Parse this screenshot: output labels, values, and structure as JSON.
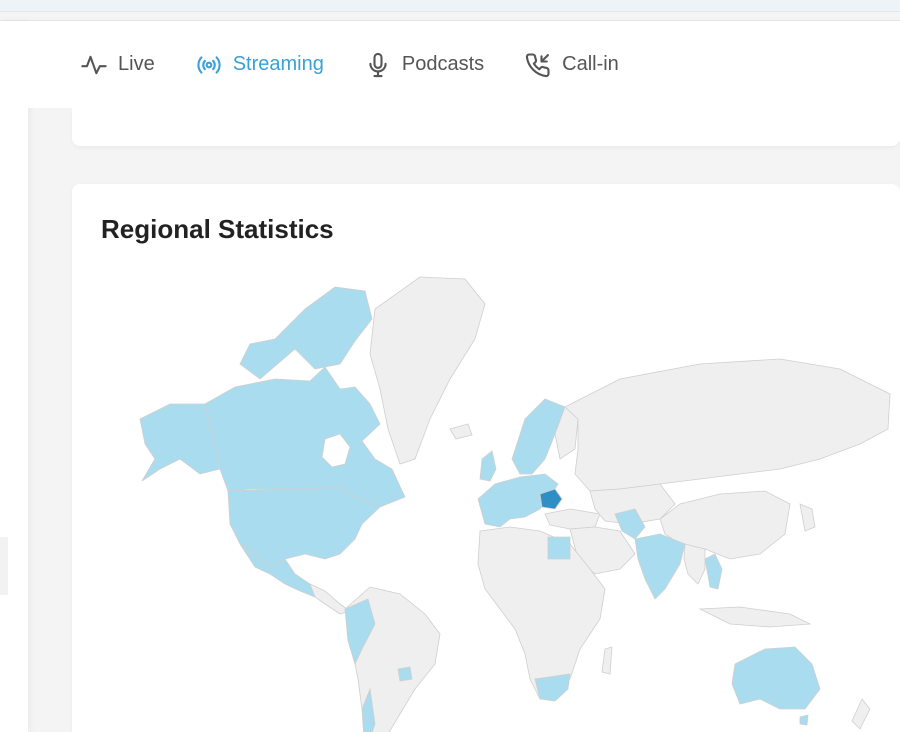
{
  "nav": {
    "items": [
      {
        "label": "Live",
        "icon": "activity-icon",
        "active": false
      },
      {
        "label": "Streaming",
        "icon": "broadcast-icon",
        "active": true
      },
      {
        "label": "Podcasts",
        "icon": "microphone-icon",
        "active": false
      },
      {
        "label": "Call-in",
        "icon": "phone-incoming-icon",
        "active": false
      }
    ]
  },
  "regional": {
    "title": "Regional Statistics",
    "colors": {
      "highlight": "#a9dcee",
      "top": "#2f8fc4",
      "base": "#efefef",
      "accent": "#3aa0d6"
    }
  }
}
